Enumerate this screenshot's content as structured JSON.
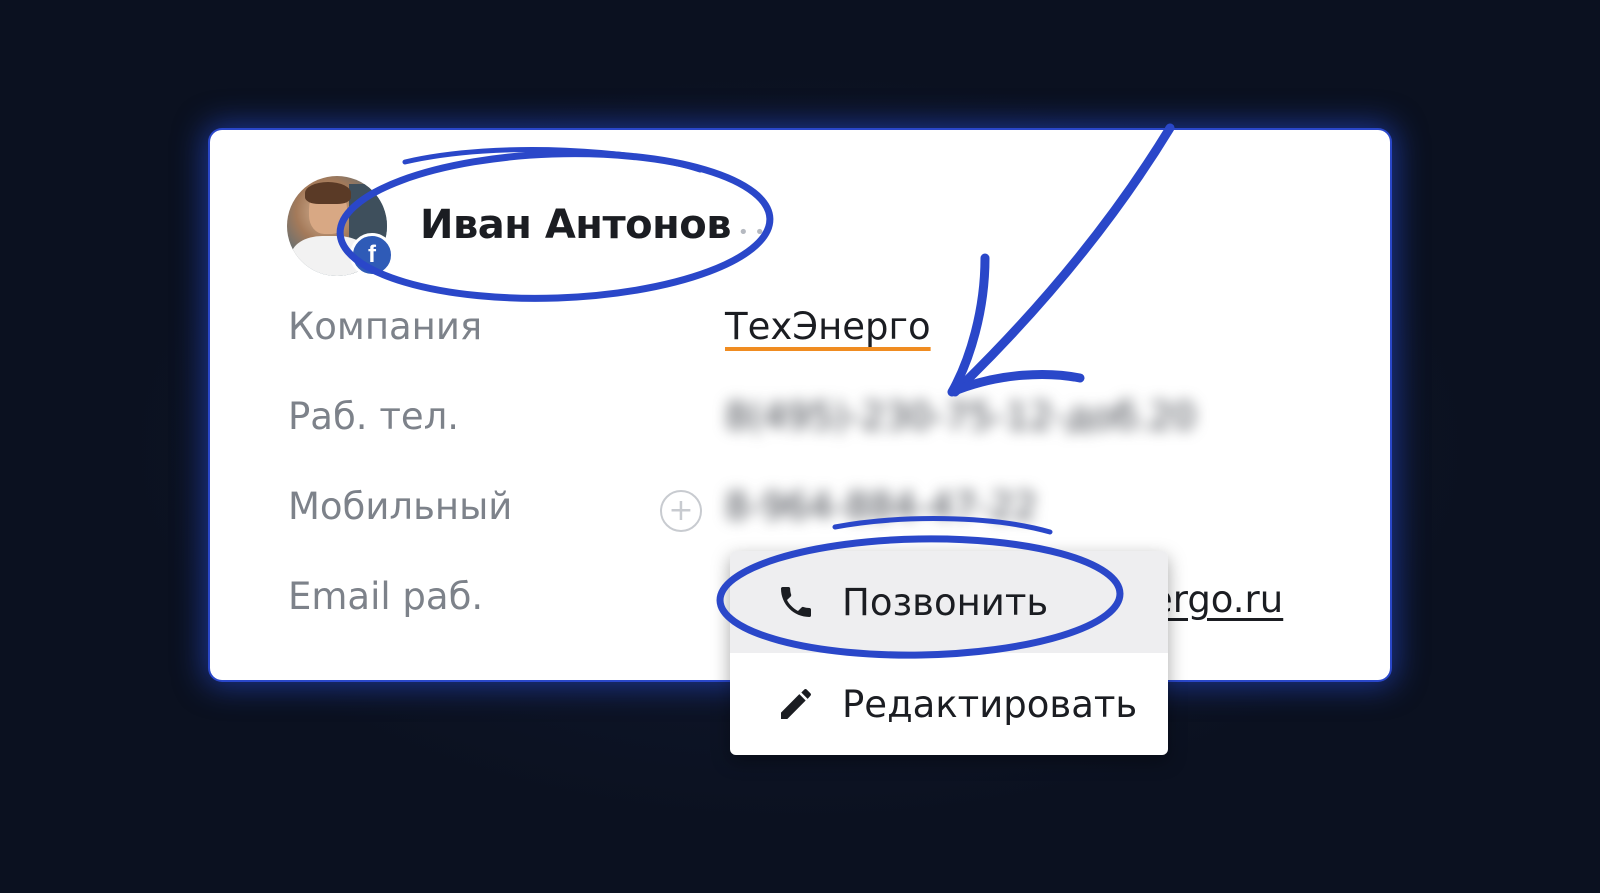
{
  "contact": {
    "name": "Иван Антонов",
    "social_badge": "f",
    "more_dots": "• •"
  },
  "fields": [
    {
      "label": "Компания",
      "value": "ТехЭнерго"
    },
    {
      "label": "Раб. тел.",
      "value": "8(495)-230-75-12-доб.20"
    },
    {
      "label": "Мобильный",
      "value": "8-964-884-47-22"
    },
    {
      "label": "Email раб.",
      "value": "ergo.ru"
    }
  ],
  "plus_button": "+",
  "context_menu": {
    "items": [
      {
        "label": "Позвонить",
        "icon": "phone-icon"
      },
      {
        "label": "Редактировать",
        "icon": "pencil-icon"
      }
    ]
  },
  "colors": {
    "annotation_blue": "#2a47c9",
    "company_underline": "#f08c21",
    "facebook_blue": "#2f5bb7"
  }
}
